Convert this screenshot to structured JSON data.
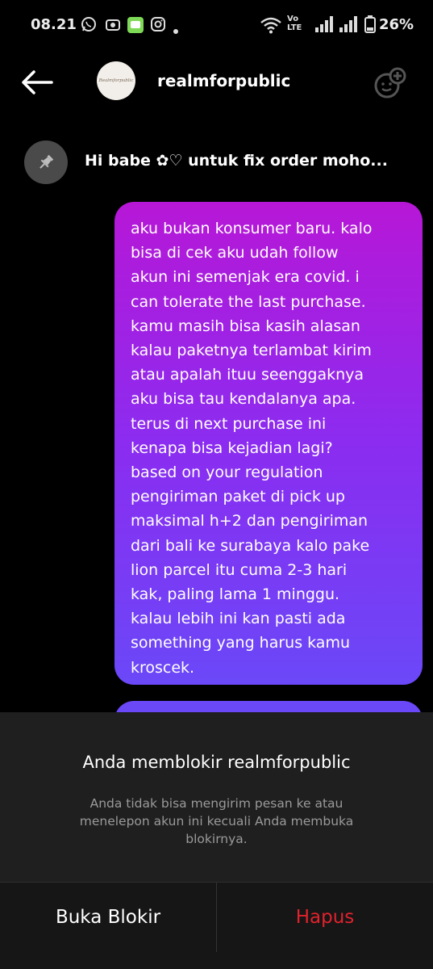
{
  "status_bar": {
    "time": "08.21",
    "network_label": "Vo LTE",
    "battery": "26%",
    "icons": [
      "whatsapp-icon",
      "camera-app-icon",
      "message-app-icon",
      "instagram-icon",
      "dot-icon",
      "wifi-icon",
      "signal-icon",
      "signal-icon",
      "battery-icon"
    ]
  },
  "header": {
    "avatar_text": "Realmforpublic",
    "username": "realmforpublic"
  },
  "pinned": {
    "text": "Hi babe ✿♡ untuk fix order moho..."
  },
  "message": {
    "lines": [
      "aku bukan konsumer baru. kalo",
      "bisa di cek aku udah follow",
      "akun ini semenjak era covid. i",
      "can tolerate the last purchase.",
      "kamu masih bisa kasih alasan",
      "kalau paketnya terlambat kirim",
      "atau apalah ituu seenggaknya",
      "aku bisa tau kendalanya apa.",
      "terus di next purchase ini",
      "kenapa bisa kejadian lagi?",
      "based on your regulation",
      "pengiriman paket di pick up",
      "maksimal h+2 dan pengiriman",
      "dari bali ke surabaya kalo pake",
      "lion parcel itu cuma 2-3 hari",
      "kak, paling lama 1 minggu.",
      "kalau lebih ini kan pasti ada",
      "something yang harus kamu",
      "kroscek."
    ]
  },
  "blocked": {
    "title": "Anda memblokir realmforpublic",
    "description": "Anda tidak bisa mengirim pesan ke atau menelepon akun ini kecuali Anda membuka blokirnya.",
    "unblock_label": "Buka Blokir",
    "delete_label": "Hapus",
    "delete_color": "#e0222d"
  },
  "colors": {
    "bubble_top": "#b717d6",
    "bubble_bottom": "#6a48f8",
    "sheet_bg": "#1f1f1f"
  }
}
